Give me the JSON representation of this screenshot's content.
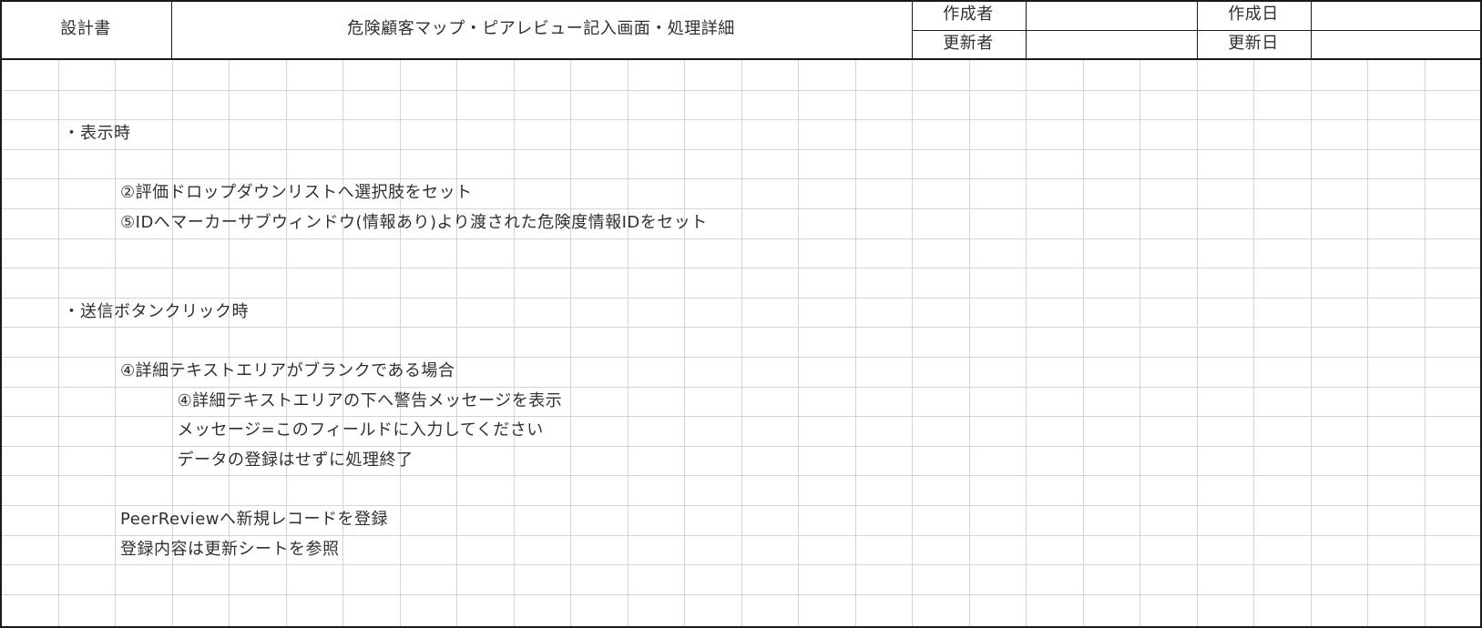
{
  "header": {
    "doc_type": "設計書",
    "title": "危険顧客マップ・ピアレビュー記入画面・処理詳細",
    "created_by_label": "作成者",
    "created_by_value": "",
    "updated_by_label": "更新者",
    "updated_by_value": "",
    "created_date_label": "作成日",
    "created_date_value": "",
    "updated_date_label": "更新日",
    "updated_date_value": ""
  },
  "lines": [
    {
      "text": "・表示時",
      "row": 2,
      "indent": 1
    },
    {
      "text": "②評価ドロップダウンリストへ選択肢をセット",
      "row": 4,
      "indent": 2
    },
    {
      "text": "⑤IDへマーカーサブウィンドウ(情報あり)より渡された危険度情報IDをセット",
      "row": 5,
      "indent": 2
    },
    {
      "text": "・送信ボタンクリック時",
      "row": 8,
      "indent": 1
    },
    {
      "text": "④詳細テキストエリアがブランクである場合",
      "row": 10,
      "indent": 2
    },
    {
      "text": "④詳細テキストエリアの下へ警告メッセージを表示",
      "row": 11,
      "indent": 3
    },
    {
      "text": "メッセージ=このフィールドに入力してください",
      "row": 12,
      "indent": 3
    },
    {
      "text": "データの登録はせずに処理終了",
      "row": 13,
      "indent": 3
    },
    {
      "text": "PeerReviewへ新規レコードを登録",
      "row": 15,
      "indent": 2
    },
    {
      "text": "登録内容は更新シートを参照",
      "row": 16,
      "indent": 2
    }
  ],
  "colors": {
    "grid_line": "#d4d4d4",
    "border": "#1a1a1a",
    "text": "#303030"
  }
}
